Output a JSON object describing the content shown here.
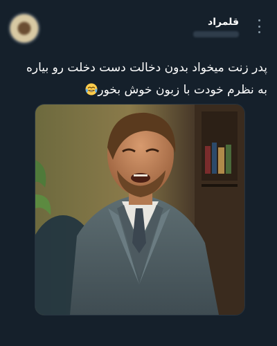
{
  "author": {
    "name": "قلمراد",
    "handle": ""
  },
  "tweet": {
    "line1": "پدر زنت میخواد بدون دخالت دست دخلت رو  بیاره",
    "line2": "به نظرم خودت با زبون خوش بخور",
    "emoji": "face-with-tears-of-joy"
  },
  "media": {
    "description_icon": "meme-image"
  },
  "colors": {
    "background": "#15202b",
    "text": "#ffffff",
    "muted": "#8899a6"
  }
}
